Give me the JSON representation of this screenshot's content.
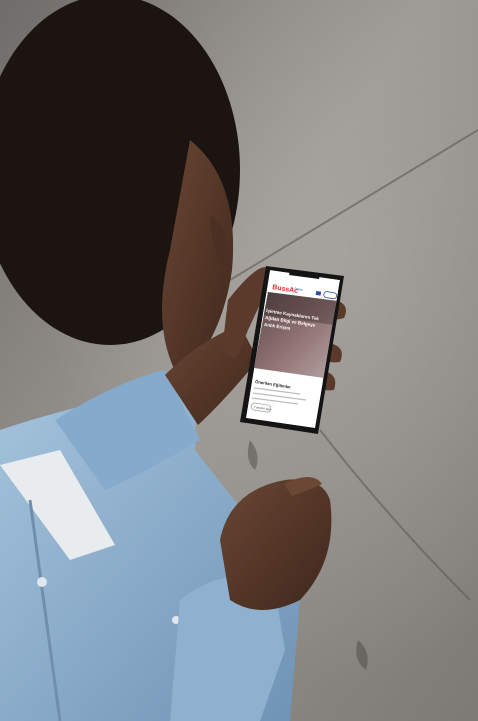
{
  "phone_screen": {
    "logo": {
      "word": "BussAc",
      "tag": "Online"
    },
    "hero": {
      "title_lines": [
        "İşletme Kaynaklarını Tek",
        "Ağdan Bilgi ve Belgeye",
        "Anlık Erişim"
      ]
    },
    "section": {
      "title": "Önerilen Eğitimler",
      "button_label": "Tümünü Gör"
    }
  },
  "colors": {
    "floor": "#8e8a86",
    "shirt": "#8fb3d1",
    "skin": "#5a3a2a",
    "hair": "#1c1410",
    "phone_frame": "#141414",
    "logo_red": "#d9302c",
    "logo_blue": "#2a4fa0"
  }
}
